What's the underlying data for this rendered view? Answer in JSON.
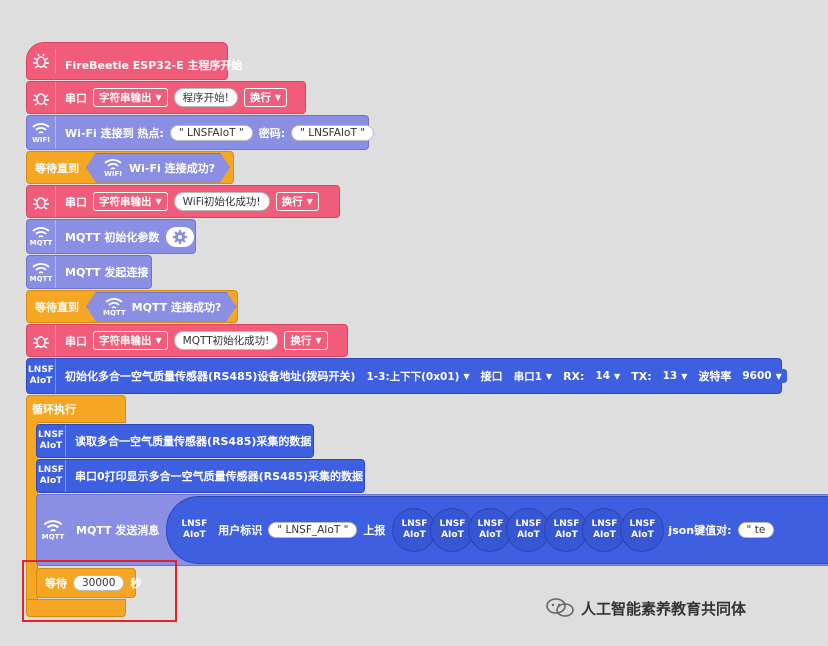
{
  "colors": {
    "pink": "#f25c7b",
    "purple": "#8a8fe3",
    "orange": "#f5a623",
    "blue": "#3e5fe0",
    "highlight": "#e0262a"
  },
  "start": {
    "label": "FireBeetle ESP32-E 主程序开始",
    "icon": "bug-icon"
  },
  "serial1": {
    "label": "串口",
    "mode": "字符串输出",
    "text": "程序开始!",
    "newline": "换行"
  },
  "wifi_connect": {
    "label": "Wi-Fi 连接到 热点:",
    "ssid": "\" LNSFAIoT \"",
    "pwd_label": "密码:",
    "pwd": "\" LNSFAIoT \"",
    "icon_text": "WIFI"
  },
  "wait_wifi": {
    "label": "等待直到",
    "cond": "Wi-Fi 连接成功?",
    "icon_text": "WIFI"
  },
  "serial2": {
    "label": "串口",
    "mode": "字符串输出",
    "text": "WiFi初始化成功!",
    "newline": "换行"
  },
  "mqtt_init": {
    "label": "MQTT 初始化参数",
    "icon_text": "MQTT"
  },
  "mqtt_connect": {
    "label": "MQTT 发起连接",
    "icon_text": "MQTT"
  },
  "wait_mqtt": {
    "label": "等待直到",
    "cond": "MQTT 连接成功?",
    "icon_text": "MQTT"
  },
  "serial3": {
    "label": "串口",
    "mode": "字符串输出",
    "text": "MQTT初始化成功!",
    "newline": "换行"
  },
  "sensor_init": {
    "icon_l1": "LNSF",
    "icon_l2": "AIoT",
    "label": "初始化多合一空气质量传感器(RS485)设备地址(拨码开关)",
    "addr": "1-3:上下下(0x01)",
    "port_label": "接口",
    "port": "串口1",
    "rx_label": "RX:",
    "rx": "14",
    "tx_label": "TX:",
    "tx": "13",
    "baud_label": "波特率",
    "baud": "9600"
  },
  "loop": {
    "label": "循环执行"
  },
  "read": {
    "icon_l1": "LNSF",
    "icon_l2": "AIoT",
    "label": "读取多合一空气质量传感器(RS485)采集的数据"
  },
  "print": {
    "icon_l1": "LNSF",
    "icon_l2": "AIoT",
    "label": "串口0打印显示多合一空气质量传感器(RS485)采集的数据"
  },
  "mqtt_send": {
    "label": "MQTT 发送消息",
    "icon_text": "MQTT",
    "user_label": "用户标识",
    "user": "\" LNSF_AIoT \"",
    "report": "上报",
    "circle_l1": "LNSF",
    "circle_l2": "AIoT",
    "json_label": "json键值对:",
    "json_value": "\" te"
  },
  "wait": {
    "label": "等待",
    "value": "30000",
    "unit": "秒"
  },
  "watermark": {
    "text": "人工智能素养教育共同体"
  }
}
